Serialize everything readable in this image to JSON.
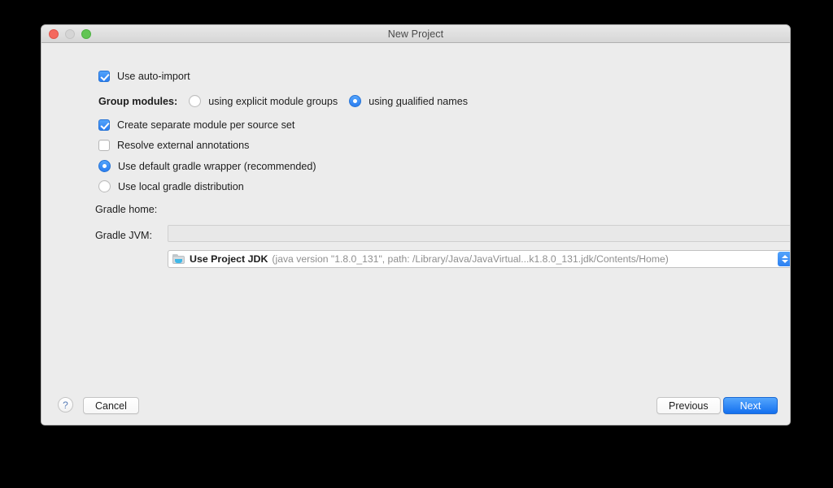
{
  "window": {
    "title": "New Project",
    "traffic_lights": [
      {
        "name": "close",
        "color": "#f4695e"
      },
      {
        "name": "minimize",
        "color": "#d5d5d5"
      },
      {
        "name": "zoom",
        "color": "#62c554"
      }
    ]
  },
  "options": {
    "auto_import": {
      "label": "Use auto-import",
      "checked": true
    },
    "group_modules": {
      "label": "Group modules:",
      "choices": [
        {
          "label_pre": "using explicit module ",
          "label_mnemonic": "g",
          "label_post": "roups",
          "selected": false
        },
        {
          "label_pre": "using ",
          "label_mnemonic": "q",
          "label_post": "ualified names",
          "selected": true
        }
      ]
    },
    "separate_module": {
      "label": "Create separate module per source set",
      "checked": true
    },
    "resolve_annotations": {
      "label": "Resolve external annotations",
      "checked": false
    },
    "gradle_wrapper": {
      "label": "Use default gradle wrapper (recommended)",
      "selected": true
    },
    "local_distribution": {
      "label": "Use local gradle distribution",
      "selected": false
    }
  },
  "gradle_home": {
    "label": "Gradle home:",
    "value": "",
    "placeholder": "",
    "browse_icon": "folder-icon",
    "enabled": false
  },
  "gradle_jvm": {
    "label": "Gradle JVM:",
    "icon": "jdk-folder-icon",
    "selected_name": "Use Project JDK",
    "selected_detail": "(java version \"1.8.0_131\", path: /Library/Java/JavaVirtual...k1.8.0_131.jdk/Contents/Home)",
    "browse_label": "...",
    "stepper_icon": "stepper-up-down-icon"
  },
  "footer": {
    "help_label": "?",
    "cancel_label": "Cancel",
    "previous_label": "Previous",
    "next_label": "Next"
  },
  "colors": {
    "accent": "#2b7ef0",
    "default_button": "#1470ef",
    "dialog_bg": "#ececec",
    "page_bg": "#000000"
  }
}
